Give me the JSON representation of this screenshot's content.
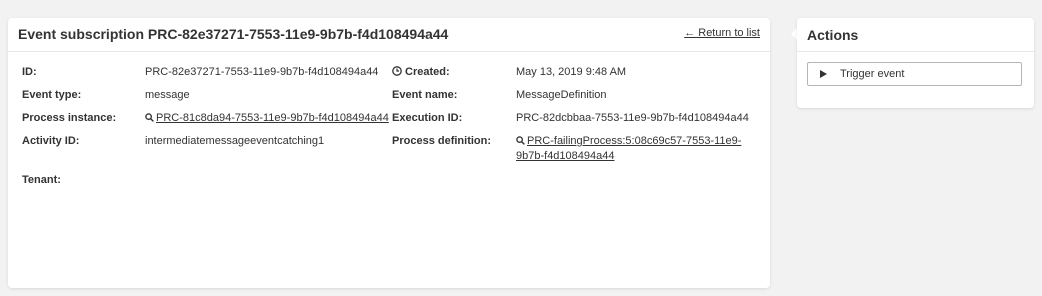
{
  "main": {
    "title": "Event subscription PRC-82e37271-7553-11e9-9b7b-f4d108494a44",
    "return_link": "← Return to list",
    "fields": {
      "id_label": "ID:",
      "id_value": "PRC-82e37271-7553-11e9-9b7b-f4d108494a44",
      "event_type_label": "Event type:",
      "event_type_value": "message",
      "process_instance_label": "Process instance:",
      "process_instance_value": "PRC-81c8da94-7553-11e9-9b7b-f4d108494a44",
      "activity_id_label": "Activity ID:",
      "activity_id_value": "intermediatemessageeventcatching1",
      "tenant_label": "Tenant:",
      "tenant_value": "",
      "created_label": "Created:",
      "created_value": "May 13, 2019 9:48 AM",
      "event_name_label": "Event name:",
      "event_name_value": "MessageDefinition",
      "execution_id_label": "Execution ID:",
      "execution_id_value": "PRC-82dcbbaa-7553-11e9-9b7b-f4d108494a44",
      "process_definition_label": "Process definition:",
      "process_definition_line1": "PRC-failingProcess:5:08c69c57-7553-11e9-",
      "process_definition_line2": "9b7b-f4d108494a44"
    }
  },
  "actions": {
    "title": "Actions",
    "trigger_label": "Trigger event"
  },
  "icons": {
    "magnifier": "magnifier-icon",
    "clock": "clock-icon",
    "play": "play-icon"
  }
}
